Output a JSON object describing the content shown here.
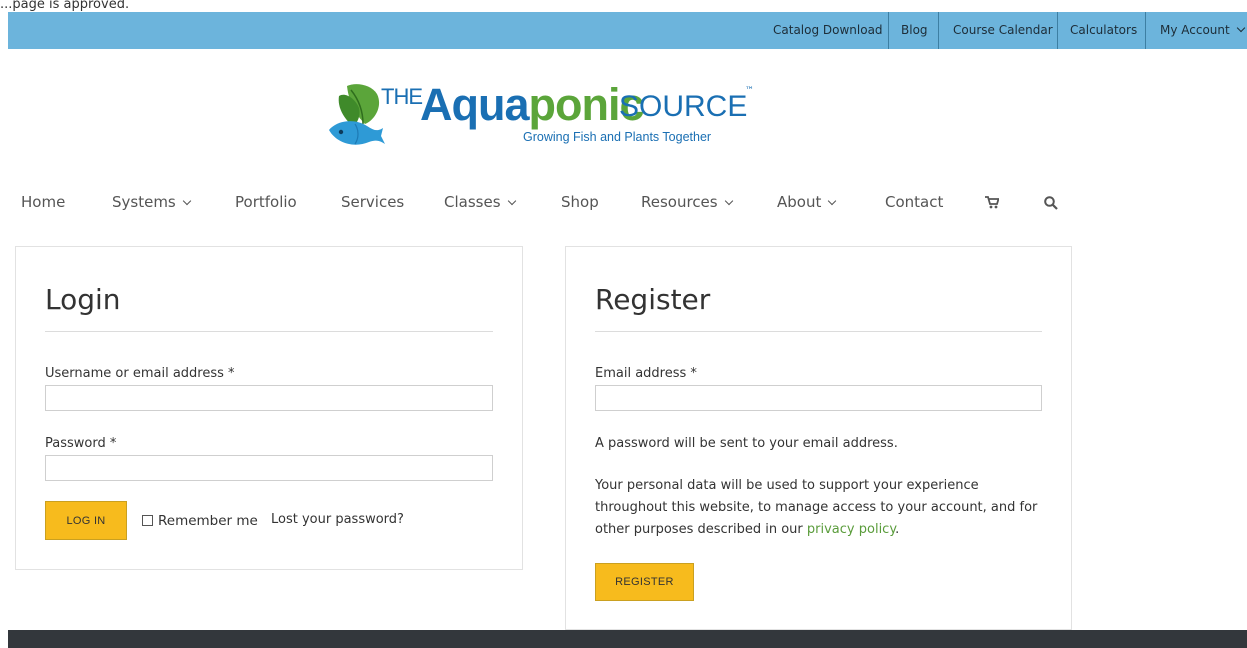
{
  "clipped_text": "...page is approved.",
  "topbar": {
    "links": [
      {
        "label": "Catalog Download"
      },
      {
        "label": "Blog"
      },
      {
        "label": "Course Calendar"
      },
      {
        "label": "Calculators"
      },
      {
        "label": "My Account"
      }
    ]
  },
  "logo": {
    "the": "THE",
    "aqua_part1": "Aqua",
    "aqua_part2": "ponic",
    "source": "SOURCE",
    "tm": "™",
    "tagline": "Growing Fish and Plants Together"
  },
  "nav": {
    "items": [
      {
        "label": "Home"
      },
      {
        "label": "Systems"
      },
      {
        "label": "Portfolio"
      },
      {
        "label": "Services"
      },
      {
        "label": "Classes"
      },
      {
        "label": "Shop"
      },
      {
        "label": "Resources"
      },
      {
        "label": "About"
      },
      {
        "label": "Contact"
      }
    ],
    "cart_icon": "cart-icon",
    "search_icon": "search-icon"
  },
  "login": {
    "title": "Login",
    "username_label": "Username or email address *",
    "username_value": "",
    "password_label": "Password *",
    "password_value": "",
    "login_button": "LOG IN",
    "remember_label": "Remember me",
    "remember_checked": false,
    "lost_password": "Lost your password?"
  },
  "register": {
    "title": "Register",
    "email_label": "Email address *",
    "email_value": "",
    "password_notice": "A password will be sent to your email address.",
    "privacy_line1": "Your personal data will be used to support your experience",
    "privacy_line2": "throughout this website, to manage access to your account, and for",
    "privacy_line3_prefix": "other purposes described in our ",
    "privacy_link": "privacy policy",
    "privacy_line3_suffix": ".",
    "register_button": "REGISTER"
  },
  "colors": {
    "topbar_bg": "#6cb4dc",
    "button_bg": "#f7bb1d",
    "link": "#5a9c3b",
    "brand_blue": "#1a6fb3",
    "brand_green": "#5ba53a",
    "footer_bg": "#33373c"
  }
}
